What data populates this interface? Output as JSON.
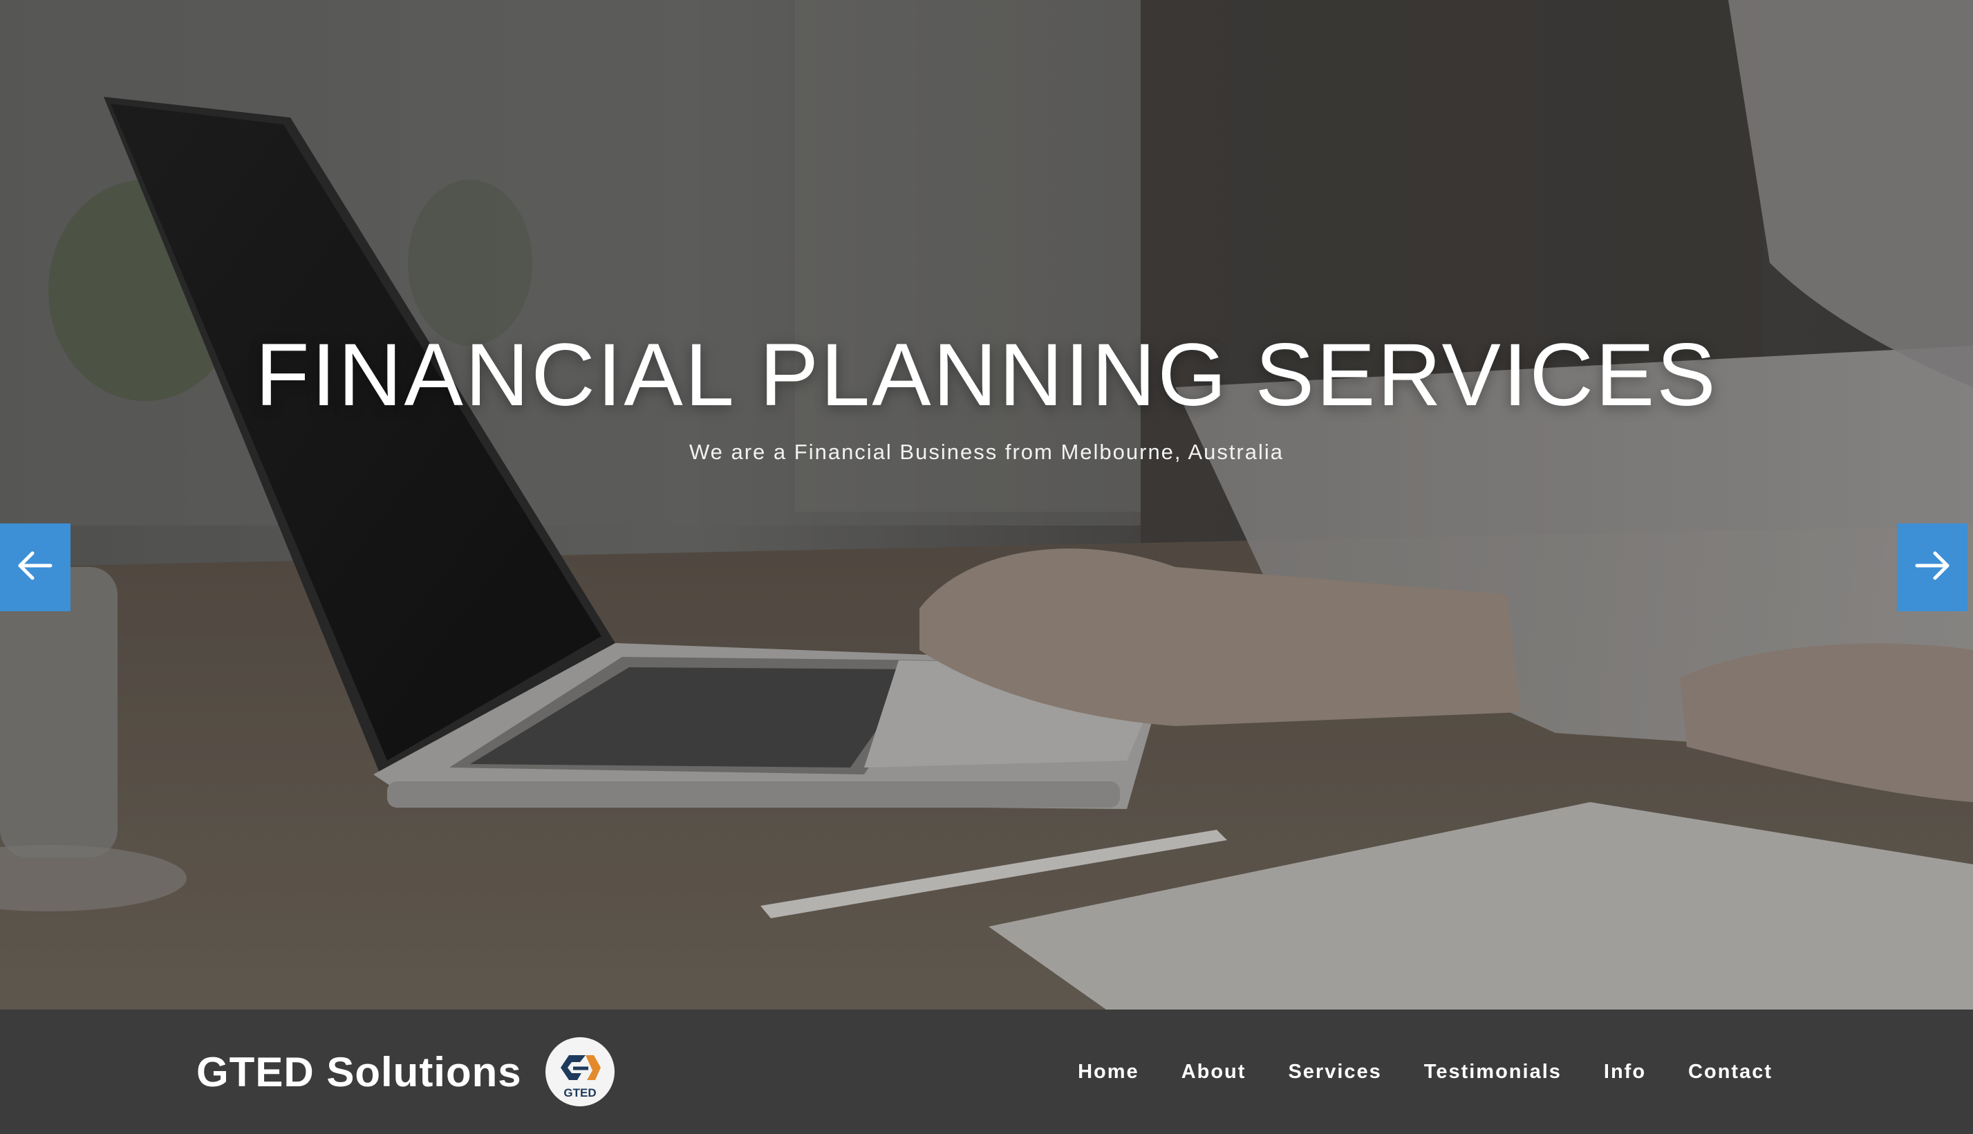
{
  "hero": {
    "title": "FINANCIAL PLANNING SERVICES",
    "subtitle": "We are a Financial Business from Melbourne, Australia",
    "prev_icon": "arrow-left-icon",
    "next_icon": "arrow-right-icon",
    "accent_color": "#3d8fd6"
  },
  "navbar": {
    "brand_name": "GTED Solutions",
    "logo_text": "GTED",
    "items": [
      {
        "label": "Home"
      },
      {
        "label": "About"
      },
      {
        "label": "Services"
      },
      {
        "label": "Testimonials"
      },
      {
        "label": "Info"
      },
      {
        "label": "Contact"
      }
    ],
    "background_color": "#3c3c3c"
  }
}
